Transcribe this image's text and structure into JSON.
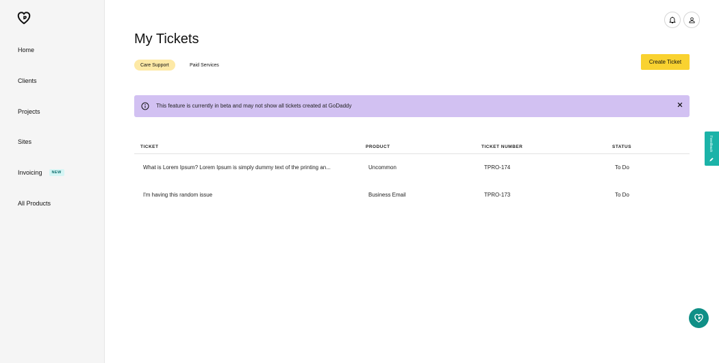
{
  "sidebar": {
    "items": [
      {
        "label": "Home"
      },
      {
        "label": "Clients"
      },
      {
        "label": "Projects"
      },
      {
        "label": "Sites"
      },
      {
        "label": "Invoicing",
        "badge": "NEW"
      },
      {
        "label": "All Products"
      }
    ]
  },
  "header": {
    "title": "My Tickets",
    "notification_icon": "bell-icon",
    "account_icon": "user-icon"
  },
  "tabs": [
    {
      "label": "Care Support",
      "active": true
    },
    {
      "label": "Paid Services",
      "active": false
    }
  ],
  "actions": {
    "create_label": "Create Ticket"
  },
  "banner": {
    "text": "This feature is currently in beta and may not show all tickets created at GoDaddy",
    "icon": "info-icon",
    "color": "#d2c1f2"
  },
  "table": {
    "columns": [
      "TICKET",
      "PRODUCT",
      "TICKET NUMBER",
      "STATUS"
    ],
    "rows": [
      {
        "ticket": "What is Lorem Ipsum? Lorem Ipsum is simply dummy text of the printing an...",
        "product": "Uncommon",
        "number": "TPRO-174",
        "status": "To Do"
      },
      {
        "ticket": "I'm having this random issue",
        "product": "Business Email",
        "number": "TPRO-173",
        "status": "To Do"
      }
    ]
  },
  "feedback": {
    "label": "Feedback"
  },
  "colors": {
    "accent": "#f9d230",
    "active_tab": "#fde9a6",
    "teal": "#1bb3a8"
  }
}
